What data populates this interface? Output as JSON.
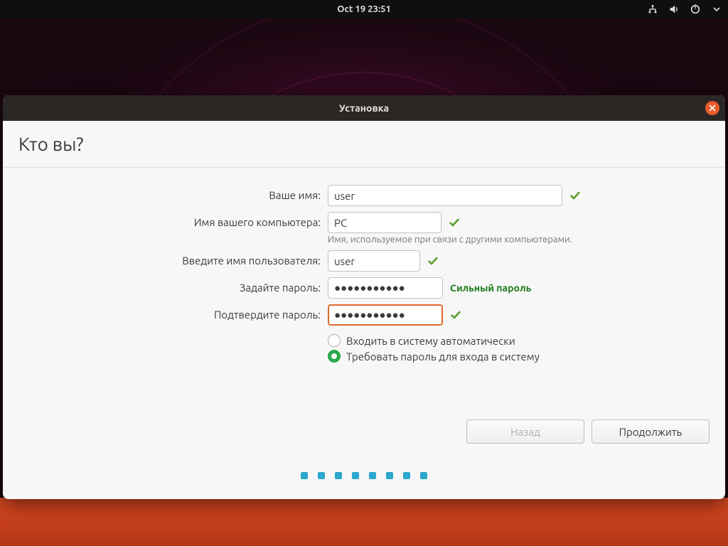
{
  "topbar": {
    "clock": "Oct 19  23:51"
  },
  "window": {
    "title": "Установка",
    "heading": "Кто вы?",
    "labels": {
      "name": "Ваше имя:",
      "hostname": "Имя вашего компьютера:",
      "hostname_hint": "Имя, используемое при связи с другими компьютерами.",
      "username": "Введите имя пользователя:",
      "password": "Задайте пароль:",
      "confirm": "Подтвердите пароль:"
    },
    "values": {
      "name": "user",
      "hostname": "PC",
      "username": "user",
      "password": "●●●●●●●●●●●",
      "confirm": "●●●●●●●●●●●",
      "strength": "Сильный пароль"
    },
    "radios": {
      "auto": "Входить в систему автоматически",
      "require": "Требовать пароль для входа в систему"
    },
    "buttons": {
      "back": "Назад",
      "continue": "Продолжить"
    }
  }
}
